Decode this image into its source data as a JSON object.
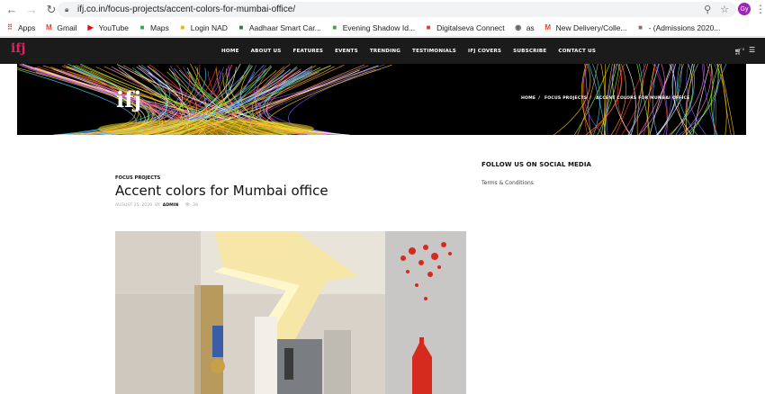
{
  "browser": {
    "url": "ifj.co.in/focus-projects/accent-colors-for-mumbai-office/",
    "profile_initials": "Gy"
  },
  "bookmarks": [
    {
      "label": "Apps",
      "icon": "apps-grid-icon",
      "color": "#ea4335"
    },
    {
      "label": "Gmail",
      "icon": "gmail-icon",
      "color": "#ea4335"
    },
    {
      "label": "YouTube",
      "icon": "youtube-icon",
      "color": "#ff0000"
    },
    {
      "label": "Maps",
      "icon": "maps-icon",
      "color": "#34a853"
    },
    {
      "label": "Login NAD",
      "icon": "nad-icon",
      "color": "#f4b400"
    },
    {
      "label": "Aadhaar Smart Car...",
      "icon": "aadhaar-icon",
      "color": "#2e7d32"
    },
    {
      "label": "Evening Shadow Id...",
      "icon": "hostinger-icon",
      "color": "#43a047"
    },
    {
      "label": "Digitalseva Connect",
      "icon": "digitalseva-icon",
      "color": "#e53935"
    },
    {
      "label": "as",
      "icon": "globe-icon",
      "color": "#5f6368"
    },
    {
      "label": "New Delivery/Colle...",
      "icon": "gmail-icon",
      "color": "#ea4335"
    },
    {
      "label": "- (Admissions 2020...",
      "icon": "admissions-icon",
      "color": "#8d6e63"
    }
  ],
  "site": {
    "logo_text": "ifj",
    "menu": [
      "HOME",
      "ABOUT US",
      "FEATURES",
      "EVENTS",
      "TRENDING",
      "TESTIMONIALS",
      "IFJ COVERS",
      "SUBSCRIBE",
      "CONTACT US"
    ],
    "cart_count": "0"
  },
  "banner": {
    "logo_text": "ifj",
    "breadcrumbs": [
      "HOME",
      "FOCUS PROJECTS",
      "ACCENT COLORS FOR MUMBAI OFFICE"
    ]
  },
  "article": {
    "category": "FOCUS PROJECTS",
    "title": "Accent colors for Mumbai office",
    "date": "AUGUST 25, 2020",
    "by": "BY",
    "author": "ADMIN",
    "views": "38"
  },
  "sidebar": {
    "heading": "FOLLOW US ON SOCIAL MEDIA",
    "link": "Terms & Conditions"
  }
}
